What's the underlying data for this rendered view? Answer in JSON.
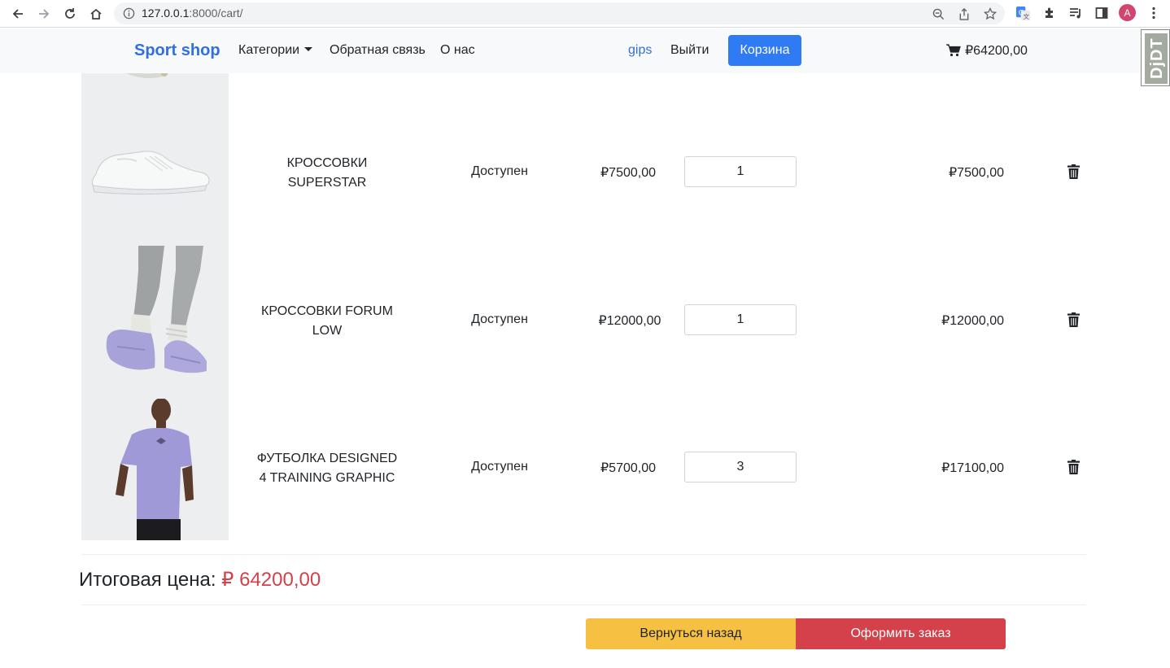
{
  "browser": {
    "url_host": "127.0.0.1",
    "url_rest": ":8000/cart/",
    "profile_initial": "A"
  },
  "navbar": {
    "brand": "Sport shop",
    "categories": "Категории",
    "feedback": "Обратная связь",
    "about": "О нас",
    "username": "gips",
    "logout": "Выйти",
    "cart_button": "Корзина",
    "cart_total": "₽64200,00"
  },
  "djdt_label": "DjDT",
  "cart": {
    "items": [
      {
        "name_line1": "КРОССОВКИ",
        "name_line2": "SUPERSTAR",
        "status": "Доступен",
        "price": "₽7500,00",
        "qty": "1",
        "subtotal": "₽7500,00"
      },
      {
        "name_line1": "КРОССОВКИ FORUM",
        "name_line2": "LOW",
        "status": "Доступен",
        "price": "₽12000,00",
        "qty": "1",
        "subtotal": "₽12000,00"
      },
      {
        "name_line1": "ФУТБОЛКА DESIGNED",
        "name_line2": "4 TRAINING GRAPHIC",
        "status": "Доступен",
        "price": "₽5700,00",
        "qty": "3",
        "subtotal": "₽17100,00"
      }
    ],
    "total_label": "Итоговая цена:",
    "total_value": "₽ 64200,00",
    "back_button": "Вернуться назад",
    "order_button": "Оформить заказ"
  }
}
